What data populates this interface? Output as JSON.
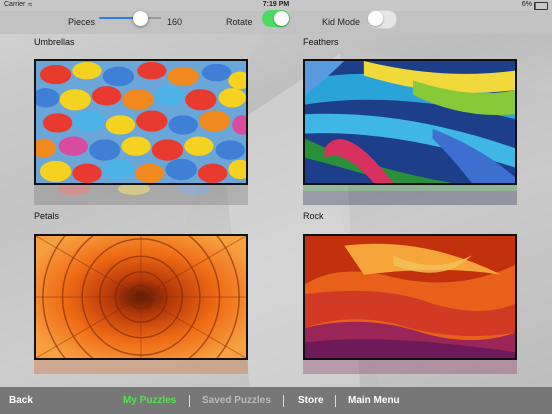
{
  "status_bar": {
    "carrier": "Carrier",
    "time": "7:19 PM",
    "battery": "6%"
  },
  "controls": {
    "pieces_label": "Pieces",
    "pieces_value": "160",
    "pieces_level": 0.67,
    "rotate_label": "Rotate",
    "rotate_on": true,
    "kid_mode_label": "Kid Mode",
    "kid_mode_on": false
  },
  "puzzles": [
    {
      "title": "Umbrellas"
    },
    {
      "title": "Feathers"
    },
    {
      "title": "Petals"
    },
    {
      "title": "Rock"
    }
  ],
  "nav": {
    "back": "Back",
    "my_puzzles": "My Puzzles",
    "saved_puzzles": "Saved Puzzles",
    "store": "Store",
    "main_menu": "Main Menu"
  },
  "colors": {
    "toggle_on": "#4cd964",
    "active_tab": "#52e34a",
    "slider": "#2e7bf6"
  },
  "icons": {
    "wifi": "wifi-icon",
    "battery": "battery-icon"
  }
}
